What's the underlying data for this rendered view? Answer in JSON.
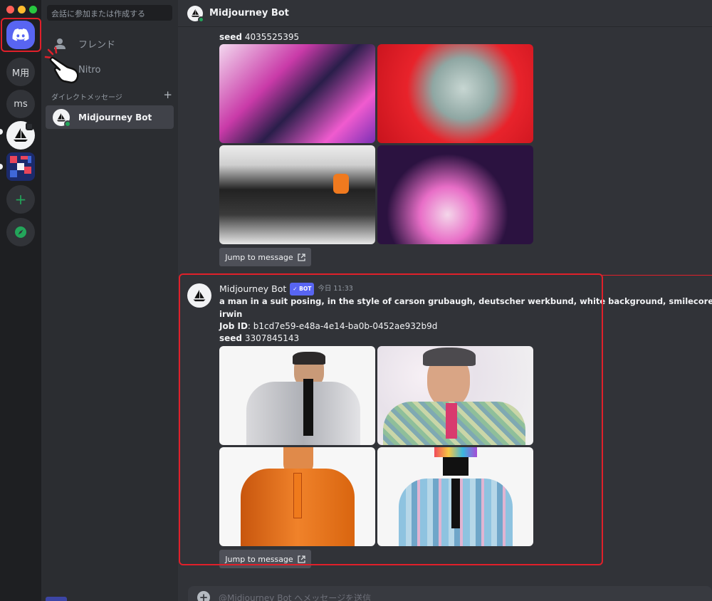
{
  "window": {
    "traffic_lights": [
      "#ff5f57",
      "#febc2e",
      "#28c840"
    ]
  },
  "servers": [
    {
      "name": "home",
      "label": ""
    },
    {
      "name": "server-m",
      "label": "M用"
    },
    {
      "name": "server-ms",
      "label": "ms"
    },
    {
      "name": "server-midjourney",
      "label": ""
    },
    {
      "name": "server-pixel",
      "label": ""
    },
    {
      "name": "add-server",
      "label": "+"
    },
    {
      "name": "explore",
      "label": ""
    }
  ],
  "sidebar": {
    "search_placeholder": "会話に参加または作成する",
    "friends_label": "フレンド",
    "nitro_label": "Nitro",
    "dm_header": "ダイレクトメッセージ",
    "dm_add": "+",
    "dm_items": [
      {
        "name": "Midjourney Bot"
      }
    ]
  },
  "header": {
    "title": "Midjourney Bot"
  },
  "messages": [
    {
      "seed_label": "seed",
      "seed_value": "4035525395",
      "jump_label": "Jump to message"
    },
    {
      "author": "Midjourney Bot",
      "bot_badge": "BOT",
      "timestamp": "今日 11:33",
      "prompt_line1": "a man in a suit posing, in the style of carson grubaugh, deutscher werkbund, white background, smilecore, jocelyn hobbie, c",
      "prompt_line2": "irwin",
      "job_label": "Job ID",
      "job_id": ": b1cd7e59-e48a-4e14-ba0b-0452ae932b9d",
      "seed_label": "seed",
      "seed_value": "3307845143",
      "jump_label": "Jump to message"
    }
  ],
  "composer": {
    "placeholder": "@Midjourney Bot へメッセージを送信",
    "plus": "+"
  },
  "colors": {
    "highlight": "#e0202a",
    "blurple": "#5865f2",
    "online": "#23a55a"
  }
}
